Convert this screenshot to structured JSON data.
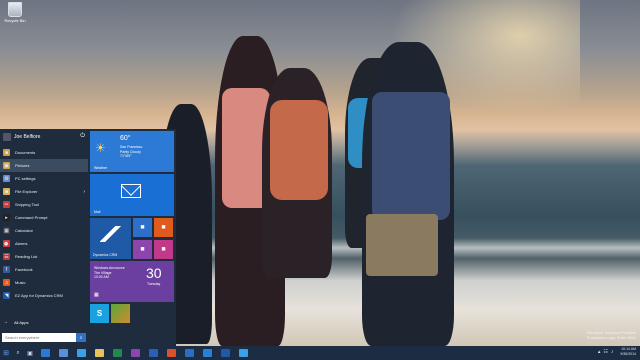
{
  "desktop": {
    "recycle_bin_label": "Recycle Bin",
    "watermark": [
      "Windows Technical Preview",
      "Evaluation copy. Build 9841"
    ]
  },
  "start_menu": {
    "user_name": "Joe Belfiore",
    "items": [
      {
        "label": "Documents",
        "icon": "folder-icon",
        "color": "#c8a24a",
        "selected": false,
        "submenu": false
      },
      {
        "label": "Pictures",
        "icon": "pictures-icon",
        "color": "#c8a24a",
        "selected": true,
        "submenu": false
      },
      {
        "label": "PC settings",
        "icon": "gear-icon",
        "color": "#6b8cc9",
        "selected": false,
        "submenu": false
      },
      {
        "label": "File Explorer",
        "icon": "folder-icon",
        "color": "#d8b35a",
        "selected": false,
        "submenu": true
      },
      {
        "label": "Snipping Tool",
        "icon": "scissors-icon",
        "color": "#c73b3b",
        "selected": false,
        "submenu": false
      },
      {
        "label": "Command Prompt",
        "icon": "terminal-icon",
        "color": "#222222",
        "selected": false,
        "submenu": false
      },
      {
        "label": "Calculator",
        "icon": "calculator-icon",
        "color": "#3a3a3a",
        "selected": false,
        "submenu": false
      },
      {
        "label": "Alarms",
        "icon": "alarm-icon",
        "color": "#d23c3c",
        "selected": false,
        "submenu": false
      },
      {
        "label": "Reading List",
        "icon": "list-icon",
        "color": "#b83a3a",
        "selected": false,
        "submenu": false
      },
      {
        "label": "Facebook",
        "icon": "facebook-icon",
        "color": "#3b5998",
        "selected": false,
        "submenu": false
      },
      {
        "label": "Music",
        "icon": "music-icon",
        "color": "#e05a1c",
        "selected": false,
        "submenu": false
      },
      {
        "label": "EZ App for Dynamics CRM",
        "icon": "crm-icon",
        "color": "#1e5aa6",
        "selected": false,
        "submenu": false
      }
    ],
    "all_apps_label": "All Apps",
    "search_placeholder": "Search everywhere",
    "tiles": {
      "weather": {
        "name": "Weather",
        "temperature": "60°",
        "location": "San Francisco",
        "condition": "Partly Cloudy",
        "range": "71°/60°"
      },
      "mail": {
        "name": "Mail"
      },
      "crm": {
        "name": "Dynamics CRM"
      },
      "small": [
        {
          "icon": "powershell-icon",
          "color": "#2e6fc9",
          "glyph": "■"
        },
        {
          "icon": "office-icon",
          "color": "#e05a1c",
          "glyph": "■"
        },
        {
          "icon": "onenote-icon",
          "color": "#8e44ad",
          "glyph": "■"
        },
        {
          "icon": "photos-icon",
          "color": "#c2388a",
          "glyph": "■"
        }
      ],
      "calendar": {
        "event": "Windows Announce",
        "location": "The Village",
        "time": "10:00 AM",
        "day": "30",
        "weekday": "Tuesday"
      }
    }
  },
  "taskbar": {
    "apps": [
      {
        "icon": "mail-app-icon",
        "color": "#2d7ad6"
      },
      {
        "icon": "people-app-icon",
        "color": "#5a8fd6"
      },
      {
        "icon": "ie-icon",
        "color": "#3aa0e8"
      },
      {
        "icon": "file-explorer-icon",
        "color": "#e8c15a"
      },
      {
        "icon": "excel-icon",
        "color": "#1f8a4a"
      },
      {
        "icon": "onenote-icon",
        "color": "#8e44ad"
      },
      {
        "icon": "word-icon",
        "color": "#2b5fb5"
      },
      {
        "icon": "powerpoint-icon",
        "color": "#d9522b"
      },
      {
        "icon": "outlook-icon",
        "color": "#2a6fc0"
      },
      {
        "icon": "lync-icon",
        "color": "#2780d6"
      },
      {
        "icon": "crm-icon",
        "color": "#1e5aa6"
      },
      {
        "icon": "remote-desktop-icon",
        "color": "#3aa0e8"
      }
    ],
    "time": "10:14 AM",
    "date": "9/30/2014"
  }
}
